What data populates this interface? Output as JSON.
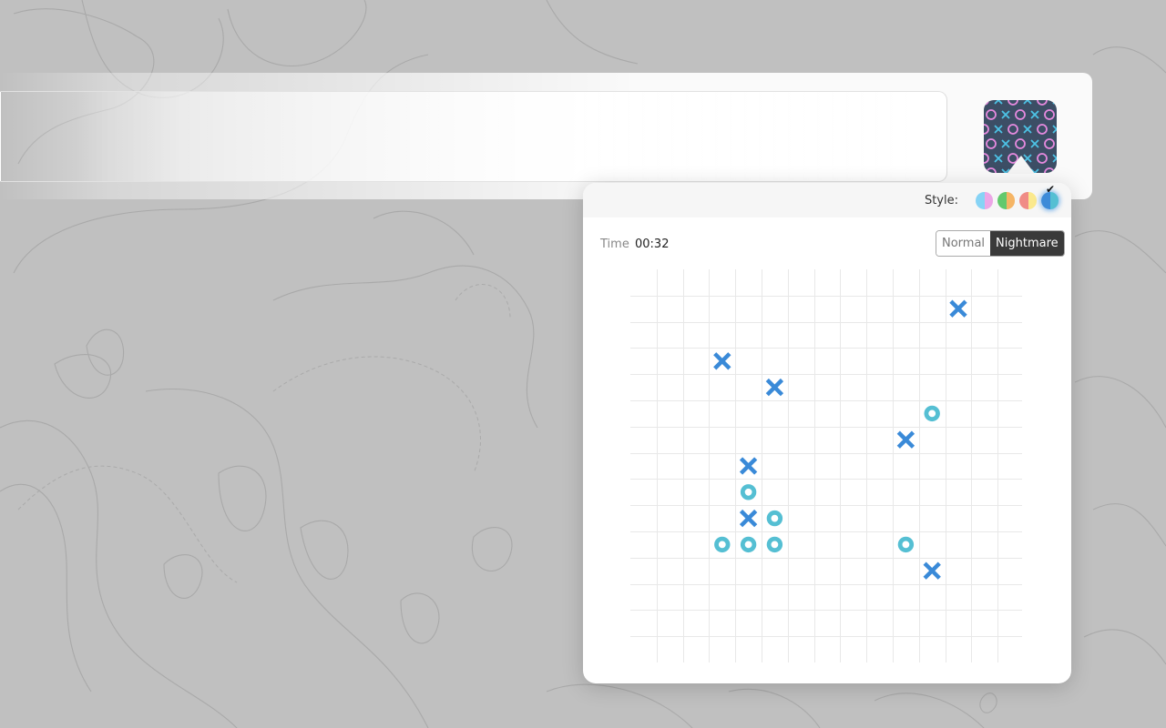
{
  "extension": {
    "icon": "tic-tac-toe-pattern-icon",
    "icon_colors": {
      "background": "#3c4e65",
      "x": "#4dc3e6",
      "o": "#e68adf"
    }
  },
  "popup": {
    "style": {
      "label": "Style:",
      "swatches": [
        {
          "name": "pastel-blue-pink",
          "left": "#86d3f5",
          "right": "#eca6e6",
          "selected": false
        },
        {
          "name": "green-orange",
          "left": "#63c96d",
          "right": "#f5b565",
          "selected": false
        },
        {
          "name": "salmon-yellow",
          "left": "#f08c86",
          "right": "#fbe98d",
          "selected": false
        },
        {
          "name": "blue-cyan",
          "left": "#3d8bd8",
          "right": "#55bfd3",
          "selected": true
        }
      ],
      "check_glyph": "✔"
    },
    "time": {
      "label": "Time",
      "value": "00:32"
    },
    "mode": {
      "options": [
        "Normal",
        "Nightmare"
      ],
      "selected": "Nightmare"
    },
    "board": {
      "cols": 15,
      "rows": 15,
      "x_color": "#3a8ad8",
      "o_color": "#55bfd3",
      "grid_color": "#e8e8e8",
      "pieces": [
        {
          "type": "X",
          "col": 12,
          "row": 1
        },
        {
          "type": "X",
          "col": 3,
          "row": 3
        },
        {
          "type": "X",
          "col": 5,
          "row": 4
        },
        {
          "type": "O",
          "col": 11,
          "row": 5
        },
        {
          "type": "X",
          "col": 10,
          "row": 6
        },
        {
          "type": "X",
          "col": 4,
          "row": 7
        },
        {
          "type": "O",
          "col": 4,
          "row": 8
        },
        {
          "type": "X",
          "col": 4,
          "row": 9
        },
        {
          "type": "O",
          "col": 5,
          "row": 9
        },
        {
          "type": "O",
          "col": 3,
          "row": 10
        },
        {
          "type": "O",
          "col": 4,
          "row": 10
        },
        {
          "type": "O",
          "col": 5,
          "row": 10
        },
        {
          "type": "O",
          "col": 10,
          "row": 10
        },
        {
          "type": "X",
          "col": 11,
          "row": 11
        }
      ]
    }
  }
}
